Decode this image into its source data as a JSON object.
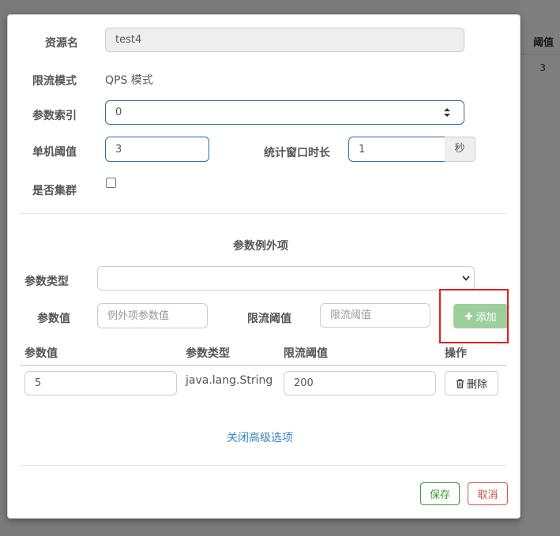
{
  "background": {
    "table_header": "阈值",
    "table_cell": "3"
  },
  "form": {
    "resource_label": "资源名",
    "resource_value": "test4",
    "mode_label": "限流模式",
    "mode_value": "QPS 模式",
    "param_index_label": "参数索引",
    "param_index_value": "0",
    "threshold_label": "单机阈值",
    "threshold_value": "3",
    "window_label": "统计窗口时长",
    "window_value": "1",
    "window_unit": "秒",
    "cluster_label": "是否集群"
  },
  "exceptions": {
    "section_title": "参数例外项",
    "param_type_label": "参数类型",
    "param_type_selected": "",
    "param_value_label": "参数值",
    "param_value_placeholder": "例外项参数值",
    "limit_label": "限流阈值",
    "limit_placeholder": "限流阈值",
    "add_icon": "plus-icon",
    "add_label": "添加",
    "table": {
      "headers": [
        "参数值",
        "参数类型",
        "限流阈值",
        "操作"
      ],
      "rows": [
        {
          "value": "5",
          "type": "java.lang.String",
          "limit": "200",
          "delete_label": "删除",
          "delete_icon": "trash-icon"
        }
      ]
    }
  },
  "advanced_link": "关闭高级选项",
  "footer": {
    "save_label": "保存",
    "cancel_label": "取消"
  },
  "colors": {
    "focus_border": "#2e6da4",
    "add_button": "#9ccf9c",
    "save": "#3c9a3c",
    "cancel": "#d9534f",
    "link": "#3a84c4",
    "highlight_box": "#e02020"
  }
}
